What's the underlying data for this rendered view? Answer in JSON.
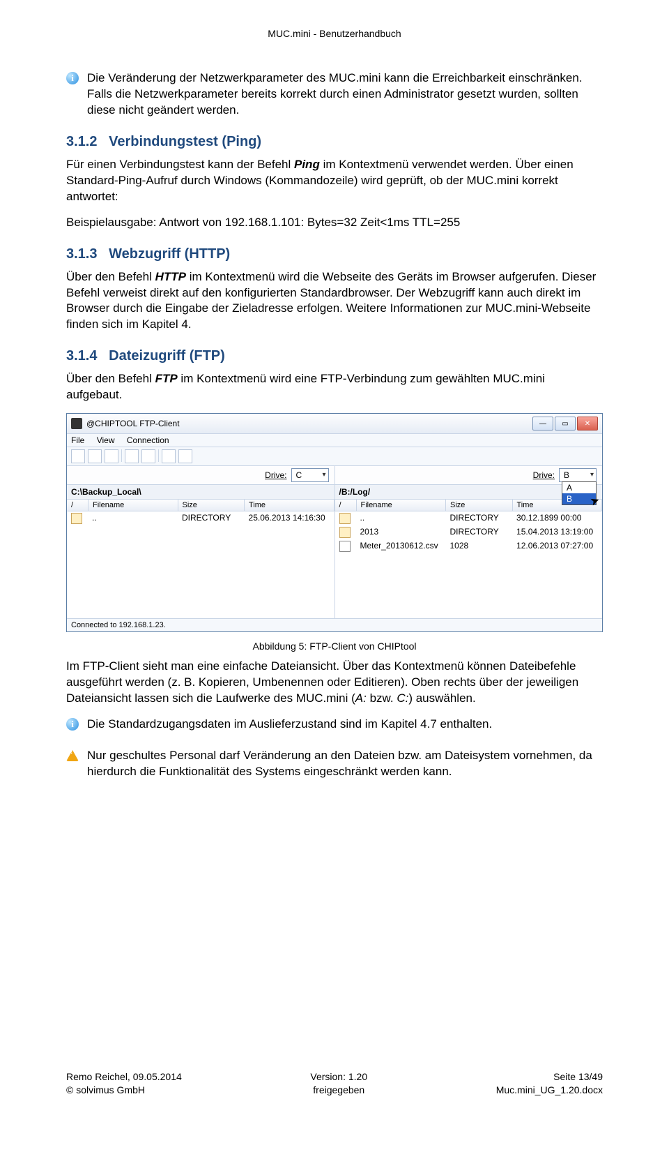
{
  "doc_header": "MUC.mini - Benutzerhandbuch",
  "info1": "Die Veränderung der Netzwerkparameter des MUC.mini kann die Erreichbarkeit einschränken. Falls die Netzwerkparameter bereits korrekt durch einen Administrator gesetzt wurden, sollten diese nicht geändert werden.",
  "sec312_num": "3.1.2",
  "sec312_title": "Verbindungstest (Ping)",
  "p312a_pre": "Für einen Verbindungstest kann der Befehl ",
  "p312a_bold": "Ping",
  "p312a_post": " im Kontextmenü verwendet werden. Über einen Standard-Ping-Aufruf durch Windows (Kommandozeile) wird geprüft, ob der MUC.mini korrekt antwortet:",
  "p312b": "Beispielausgabe: Antwort von 192.168.1.101: Bytes=32 Zeit<1ms TTL=255",
  "sec313_num": "3.1.3",
  "sec313_title": "Webzugriff (HTTP)",
  "p313_pre": "Über den Befehl ",
  "p313_bold": "HTTP",
  "p313_post": " im Kontextmenü wird die Webseite des Geräts im Browser aufgerufen. Dieser Befehl verweist direkt auf den konfigurierten Standardbrowser. Der Webzugriff kann auch direkt im Browser durch die Eingabe der Zieladresse erfolgen. Weitere Informationen zur MUC.mini-Webseite finden sich im Kapitel 4.",
  "sec314_num": "3.1.4",
  "sec314_title": "Dateizugriff (FTP)",
  "p314_pre": "Über den Befehl ",
  "p314_bold": "FTP",
  "p314_post": " im Kontextmenü wird eine FTP-Verbindung zum gewählten MUC.mini aufgebaut.",
  "ftp": {
    "title": "@CHIPTOOL FTP-Client",
    "menu_file": "File",
    "menu_view": "View",
    "menu_conn": "Connection",
    "drive_label": "Drive:",
    "drive_left_value": "C",
    "drive_right_value": "B",
    "drop_a": "A",
    "drop_b": "B",
    "path_left": "C:\\Backup_Local\\",
    "path_right": "/B:/Log/",
    "hdr_name": "Filename",
    "hdr_size": "Size",
    "hdr_time": "Time",
    "left_rows": [
      {
        "name": "..",
        "size": "DIRECTORY",
        "time": "25.06.2013 14:16:30"
      }
    ],
    "right_rows": [
      {
        "name": "..",
        "size": "DIRECTORY",
        "time": "30.12.1899 00:00"
      },
      {
        "name": "2013",
        "size": "DIRECTORY",
        "time": "15.04.2013 13:19:00"
      },
      {
        "name": "Meter_20130612.csv",
        "size": "1028",
        "time": "12.06.2013 07:27:00"
      }
    ],
    "status": "Connected to 192.168.1.23."
  },
  "caption": "Abbildung 5: FTP-Client von CHIPtool",
  "p_after1": "Im FTP-Client sieht man eine einfache Dateiansicht. Über das Kontextmenü können Dateibefehle ausgeführt werden (z. B. Kopieren, Umbenennen oder Editieren). Oben rechts über der jeweiligen Dateiansicht lassen sich die Laufwerke des MUC.mini (",
  "p_after1_iA": "A:",
  "p_after1_mid": " bzw. ",
  "p_after1_iC": "C:",
  "p_after1_end": ") auswählen.",
  "info2": "Die Standardzugangsdaten im Auslieferzustand sind im Kapitel 4.7 enthalten.",
  "warn1": "Nur geschultes Personal darf Veränderung an den Dateien bzw. am Dateisystem vornehmen, da hierdurch die Funktionalität des Systems eingeschränkt werden kann.",
  "footer": {
    "l1": "Remo Reichel, 09.05.2014",
    "l2": "© solvimus GmbH",
    "c1": "Version: 1.20",
    "c2": "freigegeben",
    "r1": "Seite 13/49",
    "r2": "Muc.mini_UG_1.20.docx"
  }
}
